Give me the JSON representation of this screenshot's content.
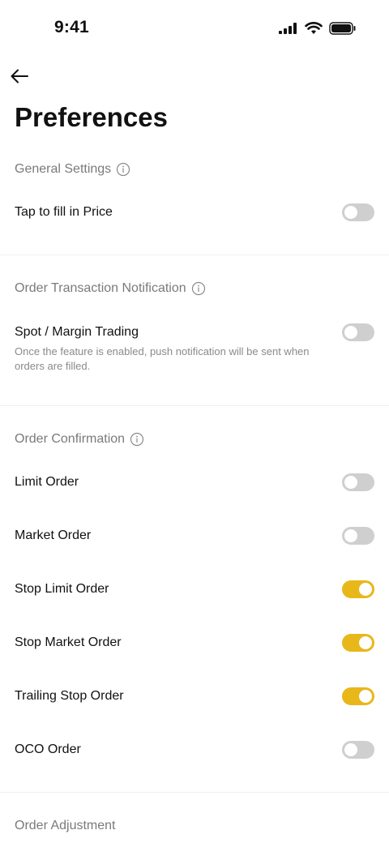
{
  "status_bar": {
    "time": "9:41"
  },
  "page": {
    "title": "Preferences"
  },
  "sections": {
    "general": {
      "header": "General Settings",
      "items": [
        {
          "label": "Tap to fill in Price",
          "enabled": false
        }
      ]
    },
    "notification": {
      "header": "Order Transaction Notification",
      "items": [
        {
          "label": "Spot / Margin Trading",
          "description": "Once the feature is enabled, push notification will be sent when orders are filled.",
          "enabled": false
        }
      ]
    },
    "confirmation": {
      "header": "Order Confirmation",
      "items": [
        {
          "label": "Limit Order",
          "enabled": false
        },
        {
          "label": "Market Order",
          "enabled": false
        },
        {
          "label": "Stop Limit Order",
          "enabled": true
        },
        {
          "label": "Stop Market Order",
          "enabled": true
        },
        {
          "label": "Trailing Stop Order",
          "enabled": true
        },
        {
          "label": "OCO Order",
          "enabled": false
        }
      ]
    },
    "adjustment": {
      "header": "Order Adjustment"
    }
  },
  "colors": {
    "toggle_on": "#e8b71a",
    "toggle_off": "#cfcfcf",
    "header_text": "#7a7a7a"
  },
  "icons": {
    "back": "arrow-left-icon",
    "info": "info-circle-icon",
    "signal": "cellular-signal-icon",
    "wifi": "wifi-icon",
    "battery": "battery-icon"
  }
}
